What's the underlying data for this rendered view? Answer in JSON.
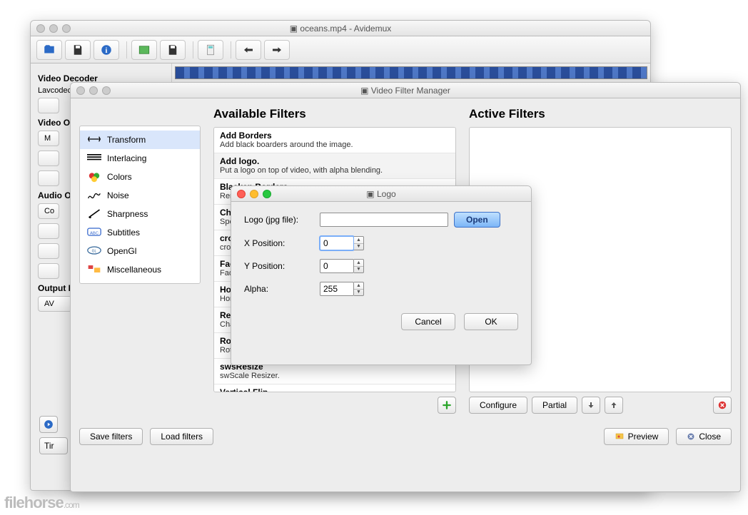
{
  "main": {
    "title": "oceans.mp4 - Avidemux",
    "side": {
      "decoder_head": "Video Decoder",
      "decoder_name": "Lavcodec",
      "video_head": "Video Output",
      "video_btn": "M",
      "audio_head": "Audio Output",
      "audio_btn": "Co",
      "output_head": "Output Format",
      "output_btn": "AV",
      "time_btn": "Tir"
    }
  },
  "fm": {
    "title": "Video Filter Manager",
    "avail_head": "Available Filters",
    "active_head": "Active Filters",
    "categories": [
      {
        "label": "Transform",
        "icon": "transform"
      },
      {
        "label": "Interlacing",
        "icon": "interlace"
      },
      {
        "label": "Colors",
        "icon": "colors"
      },
      {
        "label": "Noise",
        "icon": "noise"
      },
      {
        "label": "Sharpness",
        "icon": "sharp"
      },
      {
        "label": "Subtitles",
        "icon": "subs"
      },
      {
        "label": "OpenGl",
        "icon": "ogl"
      },
      {
        "label": "Miscellaneous",
        "icon": "misc"
      }
    ],
    "filters": [
      {
        "name": "Add Borders",
        "desc": "Add black boarders around the image."
      },
      {
        "name": "Add logo.",
        "desc": "Put a logo on top of video, with alpha blending."
      },
      {
        "name": "Blacken Borders",
        "desc": "Remove noisy"
      },
      {
        "name": "Change FPS",
        "desc": "Speed up/slow"
      },
      {
        "name": "crop",
        "desc": "crop filter"
      },
      {
        "name": "Fade",
        "desc": "Fade in/out."
      },
      {
        "name": "Horizontal Flip",
        "desc": "Horizontally fl"
      },
      {
        "name": "Resample",
        "desc": "Change and en"
      },
      {
        "name": "Rotate",
        "desc": "Rotate the ima"
      },
      {
        "name": "swsResize",
        "desc": "swScale Resizer."
      },
      {
        "name": "Vertical Flip",
        "desc": ""
      }
    ],
    "buttons": {
      "configure": "Configure",
      "partial": "Partial",
      "save": "Save filters",
      "load": "Load filters",
      "preview": "Preview",
      "close": "Close"
    }
  },
  "logo": {
    "title": "Logo",
    "file_label": "Logo (jpg file):",
    "file_value": "",
    "open": "Open",
    "x_label": "X Position:",
    "x_value": "0",
    "y_label": "Y Position:",
    "y_value": "0",
    "alpha_label": "Alpha:",
    "alpha_value": "255",
    "cancel": "Cancel",
    "ok": "OK"
  },
  "watermark": "filehorse",
  "watermark_ext": ".com"
}
